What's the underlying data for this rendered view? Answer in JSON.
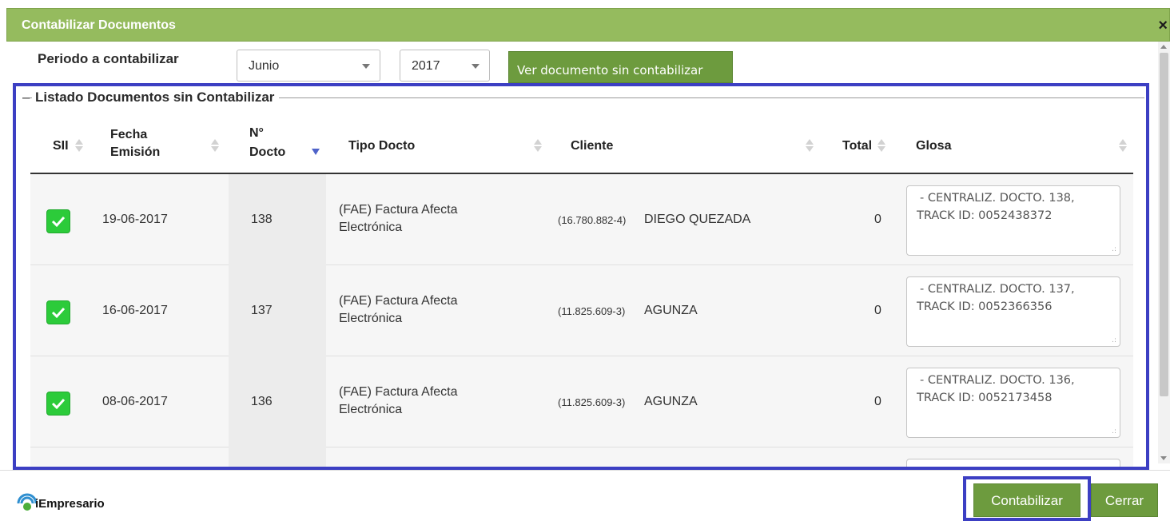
{
  "dialog": {
    "title": "Contabilizar Documentos",
    "close_icon": "×"
  },
  "periodo": {
    "label": "Periodo a contabilizar",
    "month_selected": "Junio",
    "year_selected": "2017",
    "ver_button_label": "Ver documento sin contabilizar"
  },
  "listado": {
    "legend": "Listado Documentos sin Contabilizar",
    "columns": {
      "sii": "SII",
      "fecha_line1": "Fecha",
      "fecha_line2": "Emisión",
      "ndocto_line1": "N°",
      "ndocto_line2": "Docto",
      "tipo": "Tipo Docto",
      "cliente": "Cliente",
      "total": "Total",
      "glosa": "Glosa"
    },
    "rows": [
      {
        "fecha": "19-06-2017",
        "ndocto": "138",
        "tipo_line1": "(FAE) Factura Afecta",
        "tipo_line2": "Electrónica",
        "cliente_id": "(16.780.882-4)",
        "cliente_name": "DIEGO QUEZADA",
        "total": "0",
        "glosa_line1": "- CENTRALIZ. DOCTO. 138,",
        "glosa_line2": "TRACK ID: 0052438372"
      },
      {
        "fecha": "16-06-2017",
        "ndocto": "137",
        "tipo_line1": "(FAE) Factura Afecta",
        "tipo_line2": "Electrónica",
        "cliente_id": "(11.825.609-3)",
        "cliente_name": "AGUNZA",
        "total": "0",
        "glosa_line1": "- CENTRALIZ. DOCTO. 137,",
        "glosa_line2": "TRACK ID: 0052366356"
      },
      {
        "fecha": "08-06-2017",
        "ndocto": "136",
        "tipo_line1": "(FAE) Factura Afecta",
        "tipo_line2": "Electrónica",
        "cliente_id": "(11.825.609-3)",
        "cliente_name": "AGUNZA",
        "total": "0",
        "glosa_line1": "- CENTRALIZ. DOCTO. 136,",
        "glosa_line2": "TRACK ID: 0052173458"
      }
    ]
  },
  "footer": {
    "logo_text": "iEmpresario",
    "contabilizar_label": "Contabilizar",
    "cerrar_label": "Cerrar"
  },
  "colors": {
    "title_bar": "#95bb5e",
    "button_green": "#6d9b3e",
    "highlight": "#3c3fc3",
    "check_green": "#2ccb3a"
  }
}
